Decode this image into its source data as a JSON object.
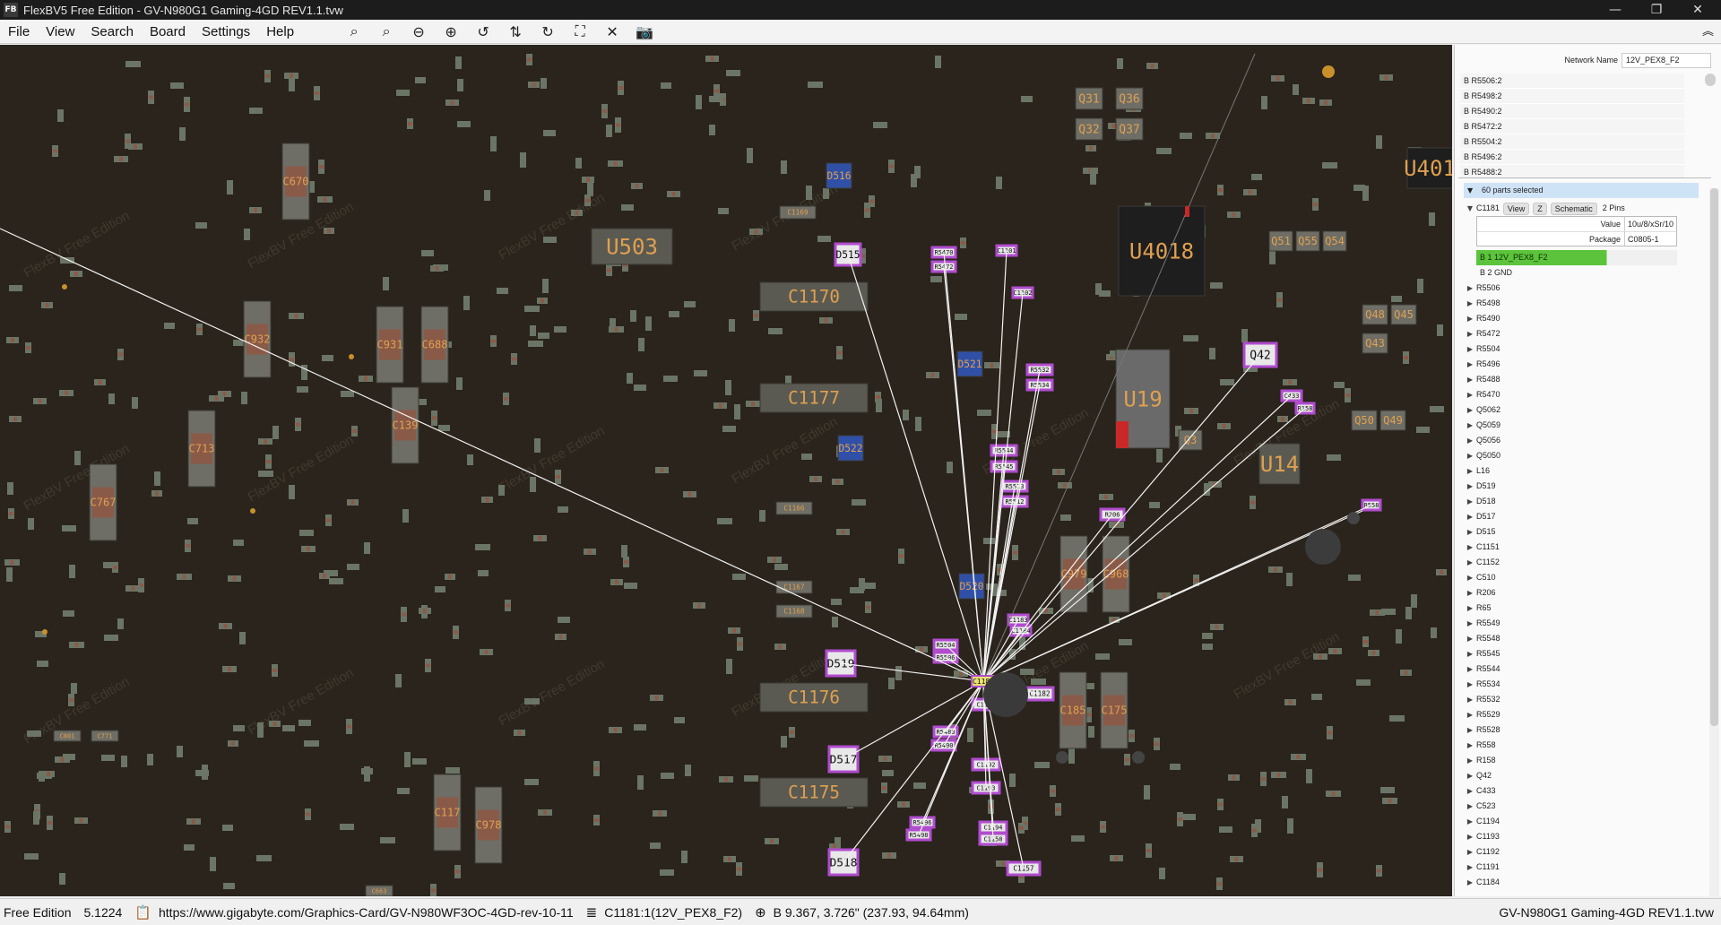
{
  "window": {
    "title": "FlexBV5 Free Edition - GV-N980G1 Gaming-4GD REV1.1.tvw",
    "icon": "flexbv-app-icon"
  },
  "menu": [
    "File",
    "View",
    "Search",
    "Board",
    "Settings",
    "Help"
  ],
  "toolbar": [
    {
      "name": "zoom-fit-icon",
      "glyph": "⌕"
    },
    {
      "name": "zoom-in-icon",
      "glyph": "⌕"
    },
    {
      "name": "zoom-out-icon",
      "glyph": "⊖"
    },
    {
      "name": "zoom-plus-icon",
      "glyph": "⊕"
    },
    {
      "name": "rotate-ccw-icon",
      "glyph": "↺"
    },
    {
      "name": "flip-icon",
      "glyph": "⇅"
    },
    {
      "name": "rotate-cw-icon",
      "glyph": "↻"
    },
    {
      "name": "fit-screen-icon",
      "glyph": "⛶"
    },
    {
      "name": "close-icon",
      "glyph": "✕"
    },
    {
      "name": "screenshot-icon",
      "glyph": "📷"
    }
  ],
  "side": {
    "network_name_label": "Network Name",
    "network_name_value": "12V_PEX8_F2",
    "net_pins": [
      "B R5506:2",
      "B R5498:2",
      "B R5490:2",
      "B R5472:2",
      "B R5504:2",
      "B R5496:2",
      "B R5488:2"
    ],
    "selected_header": "60 parts selected",
    "part": {
      "name": "C1181",
      "view_btn": "View",
      "z_btn": "Z",
      "schematic_btn": "Schematic",
      "pins": "2 Pins",
      "value_label": "Value",
      "value": "10u/8/xSr/10",
      "package_label": "Package",
      "package": "C0805-1",
      "pin1": "B   1  12V_PEX8_F2",
      "pin2": "B   2  GND"
    },
    "parts": [
      "R5506",
      "R5498",
      "R5490",
      "R5472",
      "R5504",
      "R5496",
      "R5488",
      "R5470",
      "Q5062",
      "Q5059",
      "Q5056",
      "Q5050",
      "L16",
      "D519",
      "D518",
      "D517",
      "D515",
      "C1151",
      "C1152",
      "C510",
      "R206",
      "R65",
      "R5549",
      "R5548",
      "R5545",
      "R5544",
      "R5534",
      "R5532",
      "R5529",
      "R5528",
      "R558",
      "R158",
      "Q42",
      "C433",
      "C523",
      "C1194",
      "C1193",
      "C1192",
      "C1191",
      "C1184"
    ]
  },
  "board": {
    "watermark": "FlexBV Free Edition",
    "hub_label": "C1181",
    "components": [
      {
        "t": "C1170",
        "big": true
      },
      {
        "t": "C1177",
        "big": true
      },
      {
        "t": "C1176",
        "big": true
      },
      {
        "t": "C1175",
        "big": true
      },
      {
        "t": "U503",
        "big": true
      },
      {
        "t": "U4018",
        "big": true
      },
      {
        "t": "U19",
        "big": true
      },
      {
        "t": "U14",
        "big": true
      },
      {
        "t": "U401",
        "big": true
      },
      {
        "t": "Q31"
      },
      {
        "t": "Q36"
      },
      {
        "t": "Q32"
      },
      {
        "t": "Q37"
      },
      {
        "t": "Q42"
      },
      {
        "t": "Q48"
      },
      {
        "t": "Q45"
      },
      {
        "t": "Q43"
      },
      {
        "t": "Q50"
      },
      {
        "t": "Q49"
      },
      {
        "t": "Q51"
      },
      {
        "t": "Q55"
      },
      {
        "t": "Q54"
      },
      {
        "t": "Q3"
      },
      {
        "t": "C670"
      },
      {
        "t": "C932"
      },
      {
        "t": "C931"
      },
      {
        "t": "C688"
      },
      {
        "t": "C139"
      },
      {
        "t": "C713"
      },
      {
        "t": "C767"
      },
      {
        "t": "C117"
      },
      {
        "t": "C978"
      },
      {
        "t": "C185"
      },
      {
        "t": "C175"
      },
      {
        "t": "C979"
      },
      {
        "t": "C968"
      },
      {
        "t": "D515"
      },
      {
        "t": "D519"
      },
      {
        "t": "D517"
      },
      {
        "t": "D518"
      },
      {
        "t": "D516"
      },
      {
        "t": "D522"
      },
      {
        "t": "D520"
      },
      {
        "t": "D521"
      },
      {
        "t": "C1169"
      },
      {
        "t": "C1166"
      },
      {
        "t": "C1167"
      },
      {
        "t": "C1168"
      },
      {
        "t": "C1182"
      },
      {
        "t": "C1191"
      },
      {
        "t": "C1192"
      },
      {
        "t": "C1193"
      },
      {
        "t": "C1194"
      },
      {
        "t": "C1158"
      },
      {
        "t": "C1157"
      },
      {
        "t": "R5470"
      },
      {
        "t": "R5472"
      },
      {
        "t": "R5544"
      },
      {
        "t": "R5545"
      },
      {
        "t": "R5513"
      },
      {
        "t": "R5512"
      },
      {
        "t": "R5532"
      },
      {
        "t": "R5534"
      },
      {
        "t": "R5504"
      },
      {
        "t": "R5506"
      },
      {
        "t": "R5488"
      },
      {
        "t": "R5490"
      },
      {
        "t": "R5496"
      },
      {
        "t": "R5498"
      },
      {
        "t": "R206"
      },
      {
        "t": "R558"
      },
      {
        "t": "C433"
      },
      {
        "t": "R158"
      },
      {
        "t": "C663"
      },
      {
        "t": "C801"
      },
      {
        "t": "C771"
      },
      {
        "t": "C1101"
      },
      {
        "t": "C1102"
      },
      {
        "t": "C1183"
      },
      {
        "t": "C1184"
      }
    ]
  },
  "status": {
    "edition": "Free Edition",
    "zoom": "5.1224",
    "url": "https://www.gigabyte.com/Graphics-Card/GV-N980WF3OC-4GD-rev-10-11",
    "net": "C1181:1(12V_PEX8_F2)",
    "coords": "B 9.367, 3.726\" (237.93, 94.64mm)",
    "board_name": "GV-N980G1 Gaming-4GD REV1.1.tvw"
  },
  "colors": {
    "canvas_bg": "#2a241c",
    "part_pad": "#6b7566",
    "part_body": "#8a5a48",
    "label": "#e0a050",
    "highlight": "#b14ccf",
    "net_line": "#f2f2f2",
    "pin_active": "#5cc43c",
    "blue_part": "#3050a8"
  }
}
